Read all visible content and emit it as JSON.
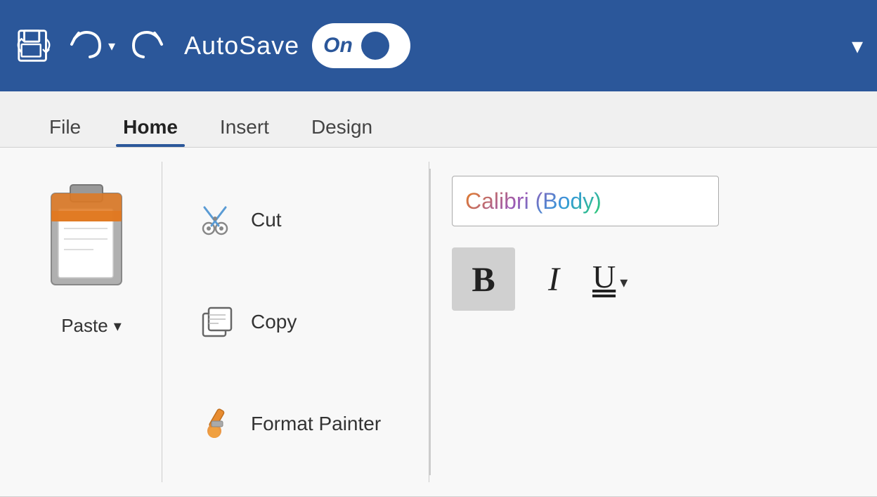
{
  "titlebar": {
    "autosave_label": "AutoSave",
    "autosave_toggle_state": "On",
    "app_color": "#2b579a"
  },
  "ribbon": {
    "tabs": [
      {
        "id": "file",
        "label": "File",
        "active": false
      },
      {
        "id": "home",
        "label": "Home",
        "active": true
      },
      {
        "id": "insert",
        "label": "Insert",
        "active": false
      },
      {
        "id": "design",
        "label": "Design",
        "active": false
      }
    ],
    "clipboard": {
      "paste_label": "Paste"
    },
    "edit_commands": [
      {
        "id": "cut",
        "label": "Cut"
      },
      {
        "id": "copy",
        "label": "Copy"
      },
      {
        "id": "format_painter",
        "label": "Format Painter"
      }
    ],
    "font": {
      "name": "Calibri (Body)"
    },
    "formatting": {
      "bold_label": "B",
      "italic_label": "I",
      "underline_label": "U"
    }
  }
}
